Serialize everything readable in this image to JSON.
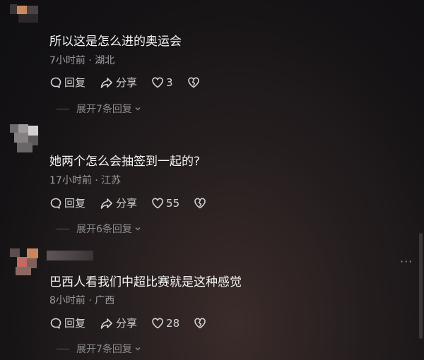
{
  "comments": [
    {
      "text": "所以这是怎么进的奥运会",
      "meta": "7小时前 · 湖北",
      "reply_label": "回复",
      "share_label": "分享",
      "likes": "3",
      "expand_label": "展开7条回复",
      "avatar_colors": [
        "#c9895e",
        "#3a3536",
        "#5b5557"
      ]
    },
    {
      "text": "她两个怎么会抽签到一起的?",
      "meta": "17小时前 · 江苏",
      "reply_label": "回复",
      "share_label": "分享",
      "likes": "55",
      "expand_label": "展开6条回复",
      "avatar_colors": [
        "#9e9a9b",
        "#d2cfd0",
        "#6f6a6b"
      ]
    },
    {
      "text": "巴西人看我们中超比赛就是这种感觉",
      "meta": "8小时前 · 广西",
      "reply_label": "回复",
      "share_label": "分享",
      "likes": "28",
      "expand_label": "展开7条回复",
      "avatar_colors": [
        "#c8865c",
        "#c46a63",
        "#8b6a63"
      ]
    }
  ],
  "icons": {
    "reply": "reply-icon",
    "share": "share-icon",
    "like": "heart-icon",
    "dislike": "broken-heart-icon",
    "expand": "chevron-down-icon",
    "more": "more-icon"
  },
  "more_label": "···"
}
